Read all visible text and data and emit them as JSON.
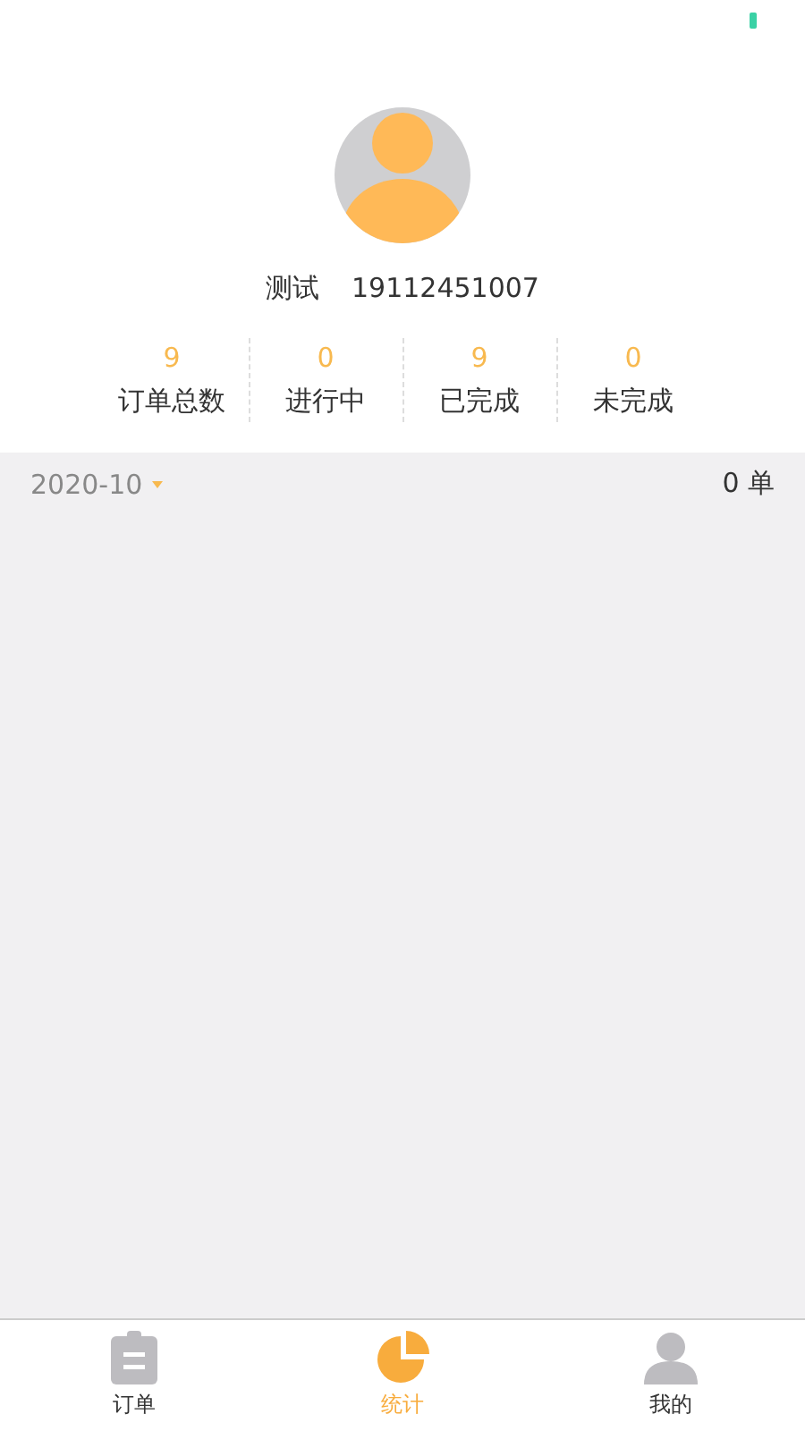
{
  "profile": {
    "name": "测试",
    "phone": "19112451007"
  },
  "stats": [
    {
      "value": "9",
      "label": "订单总数"
    },
    {
      "value": "0",
      "label": "进行中"
    },
    {
      "value": "9",
      "label": "已完成"
    },
    {
      "value": "0",
      "label": "未完成"
    }
  ],
  "filter": {
    "month": "2020-10",
    "count": "0 单"
  },
  "tabs": [
    {
      "label": "订单",
      "selected": false
    },
    {
      "label": "统计",
      "selected": true
    },
    {
      "label": "我的",
      "selected": false
    }
  ]
}
